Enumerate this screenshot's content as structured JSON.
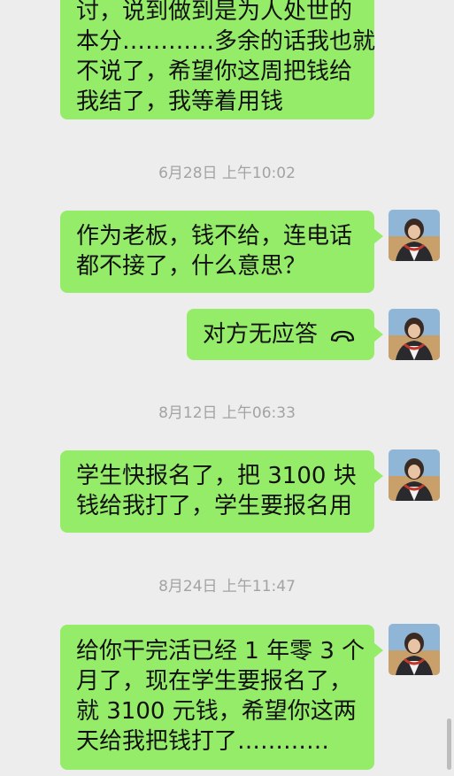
{
  "messages": [
    {
      "lines": [
        "讨，说到做到是为人处世的",
        "本分…………多余的话我也就",
        "不说了，希望你这周把钱给",
        "我结了，我等着用钱"
      ]
    },
    {
      "lines": [
        "作为老板，钱不给，连电话",
        "都不接了，什么意思？"
      ]
    },
    {
      "text": "对方无应答",
      "icon": "phone-hangup-icon"
    },
    {
      "lines": [
        "学生快报名了，把 3100 块",
        "钱给我打了，学生要报名用"
      ]
    },
    {
      "lines": [
        "给你干完活已经 1 年零 3 个",
        "月了，现在学生要报名了，",
        "就 3100 元钱，希望你这两",
        "天给我把钱打了…………"
      ]
    }
  ],
  "timestamps": [
    "6月28日 上午10:02",
    "8月12日 上午06:33",
    "8月24日 上午11:47"
  ],
  "colors": {
    "bubble": "#95ec69",
    "background": "#ededed",
    "timestamp": "#a3a3a3"
  }
}
